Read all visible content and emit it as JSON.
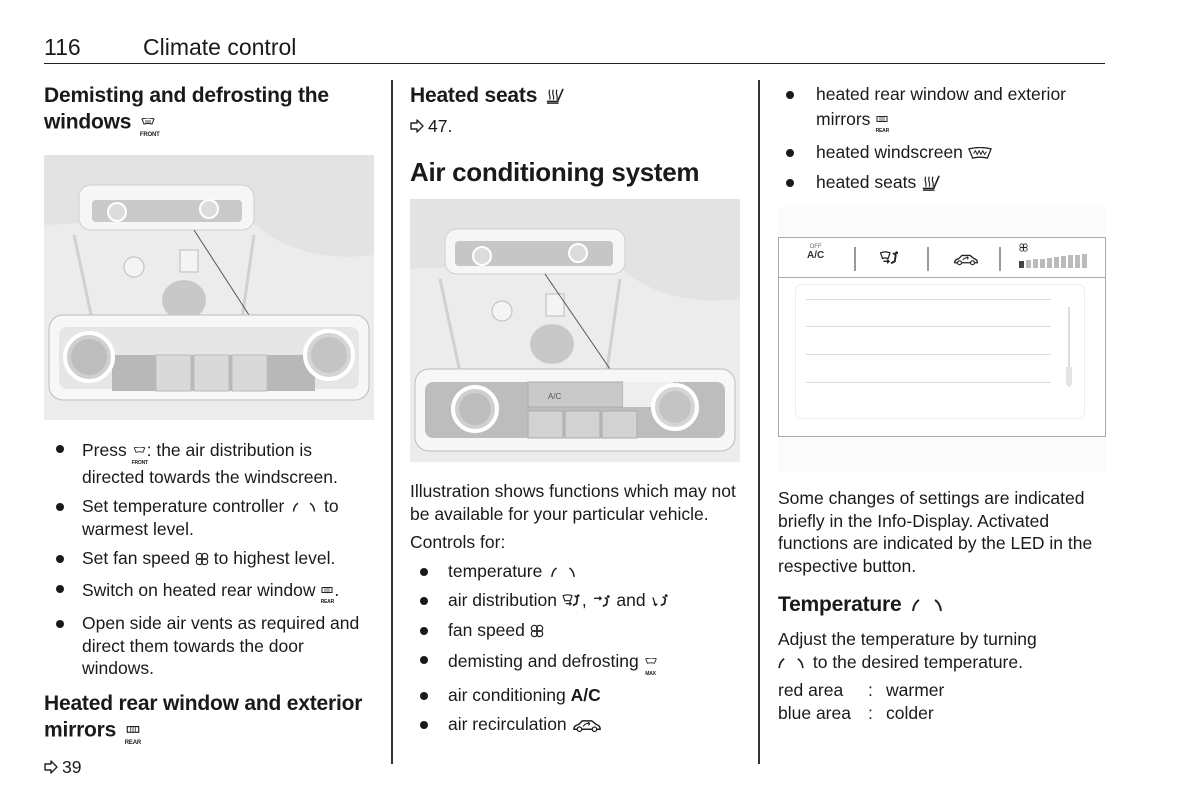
{
  "header": {
    "page_number": "116",
    "section_title": "Climate control"
  },
  "col1": {
    "heading1_line1": "Demisting and defrosting the",
    "heading1_line2": "windows",
    "heading1_icon_label": "FRONT",
    "bullets": [
      {
        "before": "Press ",
        "icon": "front-defrost-icon",
        "icon_label": "FRONT",
        "after": ": the air distribution is directed towards the windscreen."
      },
      {
        "before": "Set temperature controller ",
        "icon": "temperature-icon",
        "after": " to warmest level."
      },
      {
        "before": "Set fan speed ",
        "icon": "fan-icon",
        "after": " to highest level."
      },
      {
        "before": "Switch on heated rear window ",
        "icon": "rear-defrost-icon",
        "icon_label": "REAR",
        "after": "."
      },
      {
        "before": "Open side air vents as required and direct them towards the door windows.",
        "icon": null,
        "after": ""
      }
    ],
    "heading2_line1": "Heated rear window and exterior",
    "heading2_line2": "mirrors",
    "heading2_icon_label": "REAR",
    "ref": "39"
  },
  "col2": {
    "heading_heated_seats": "Heated seats",
    "ref": "47.",
    "title": "Air conditioning system",
    "illustration_caption": "Illustration shows functions which may not be available for your particular vehicle.",
    "controls_for": "Controls for:",
    "panel_labels": {
      "ac": "A/C"
    },
    "bullets": [
      {
        "before": "temperature ",
        "icons": [
          "temperature-icon"
        ],
        "after": ""
      },
      {
        "before": "air distribution ",
        "icons": [
          "air-windscreen-feet-icon",
          "air-face-icon",
          "air-feet-icon"
        ],
        "joiners": [
          ", ",
          " and "
        ],
        "after": ""
      },
      {
        "before": "fan speed ",
        "icons": [
          "fan-icon"
        ],
        "after": ""
      },
      {
        "before": "demisting and defrosting ",
        "icons": [
          "max-defrost-icon"
        ],
        "icon_label": "MAX",
        "after": ""
      },
      {
        "before": "air conditioning ",
        "bold": "A/C",
        "after": ""
      },
      {
        "before": "air recirculation ",
        "icons": [
          "recirculation-icon"
        ],
        "after": ""
      }
    ]
  },
  "col3": {
    "bullets": [
      {
        "before": "heated rear window and exterior mirrors ",
        "icon": "rear-defrost-icon",
        "icon_label": "REAR"
      },
      {
        "before": "heated windscreen ",
        "icon": "heated-windscreen-icon"
      },
      {
        "before": "heated seats ",
        "icon": "heated-seat-icon"
      }
    ],
    "display": {
      "ac_off_label": "OFF",
      "ac_label": "A/C",
      "fan_level_fraction": 0.1
    },
    "paragraph": "Some changes of settings are indicated briefly in the Info-Display. Activated functions are indicated by the LED in the respective button.",
    "temperature_heading": "Temperature",
    "temperature_text_1": "Adjust the temperature by turning",
    "temperature_text_2": " to the desired temperature.",
    "legend": [
      {
        "key": "red area",
        "value": "warmer"
      },
      {
        "key": "blue area",
        "value": "colder"
      }
    ],
    "legend_sep": ":"
  }
}
